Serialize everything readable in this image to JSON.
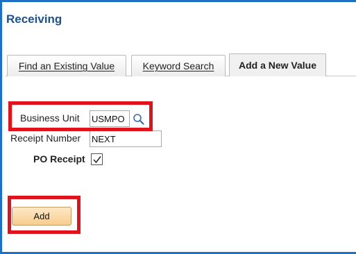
{
  "page": {
    "title": "Receiving"
  },
  "tabs": [
    {
      "label": "Find an Existing Value",
      "active": false
    },
    {
      "label": "Keyword Search",
      "active": false
    },
    {
      "label": "Add a New Value",
      "active": true
    }
  ],
  "form": {
    "business_unit": {
      "label": "Business Unit",
      "value": "USMPO"
    },
    "receipt_number": {
      "label": "Receipt Number",
      "value": "NEXT"
    },
    "po_receipt": {
      "label": "PO Receipt",
      "checked": true
    }
  },
  "actions": {
    "add_label": "Add"
  },
  "icons": {
    "lookup": "magnifying-glass-icon",
    "checkmark": "checkmark-icon"
  },
  "colors": {
    "accent": "#1f6fc4",
    "title": "#1d4f91",
    "highlight": "#e1121b",
    "button": "#f7cc8e"
  }
}
